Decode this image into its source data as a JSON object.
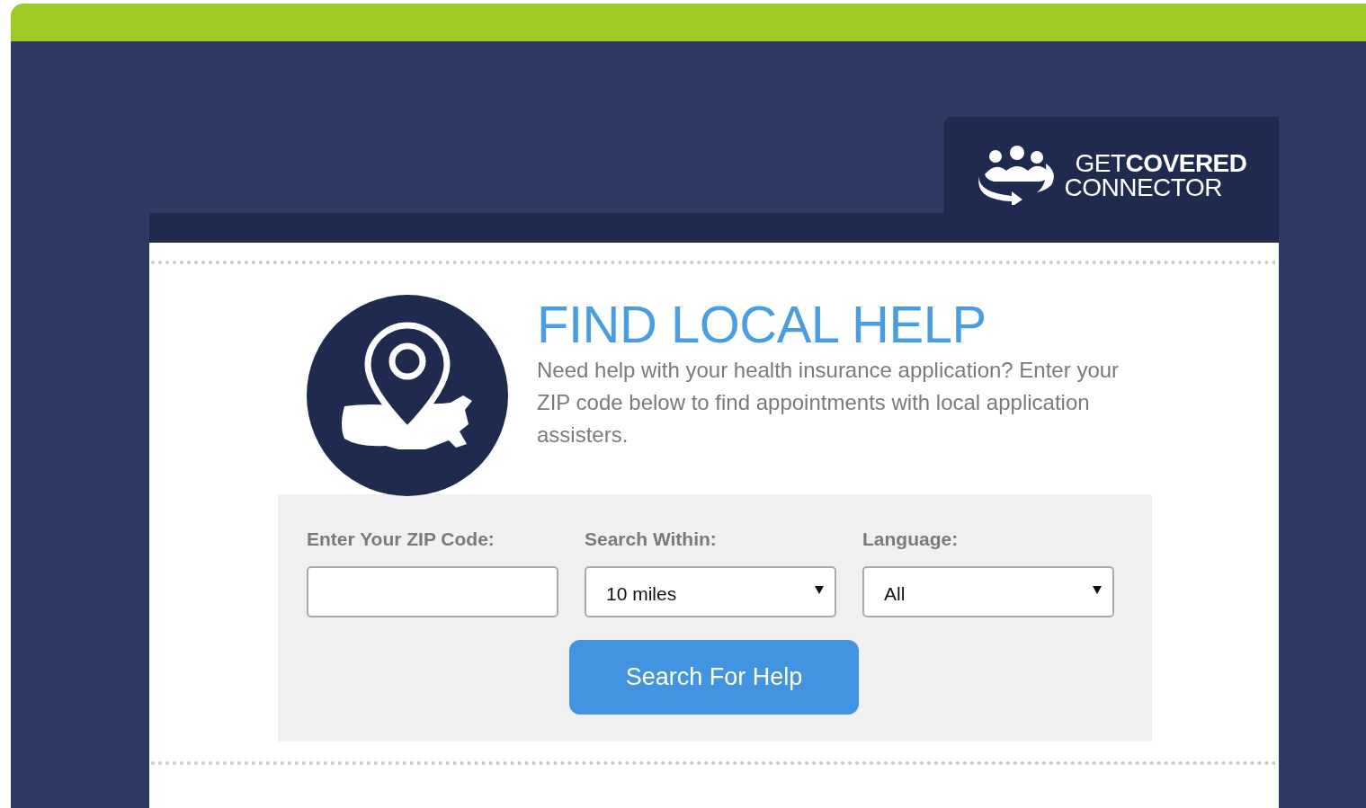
{
  "logo": {
    "line1": "GET**COVERED**",
    "line2": "CONNECTOR"
  },
  "heading": "FIND LOCAL HELP",
  "intro": "Need help with your health insurance application? Enter your ZIP code below to find appointments with local application assisters.",
  "form": {
    "fields": [
      {
        "kind": "text",
        "label": "Enter Your ZIP Code:"
      },
      {
        "kind": "select",
        "label": "Search Within:",
        "value": "10 miles"
      },
      {
        "kind": "select",
        "label": "Language:",
        "value": "All"
      }
    ],
    "button": "Search For Help"
  }
}
